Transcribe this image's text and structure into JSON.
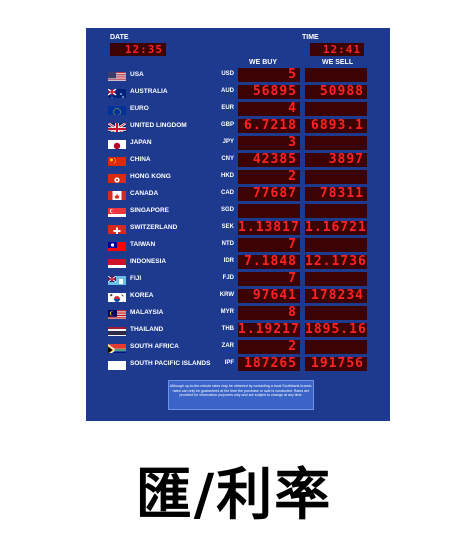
{
  "header": {
    "date_label": "DATE",
    "date_value": "12:35",
    "time_label": "TIME",
    "time_value": "12:41",
    "buy_label": "WE BUY",
    "sell_label": "WE SELL"
  },
  "rates": [
    {
      "country": "USA",
      "code": "USD",
      "buy": "5",
      "sell": "",
      "flag": "flag-usa-icon"
    },
    {
      "country": "AUSTRALIA",
      "code": "AUD",
      "buy": "56895",
      "sell": "50988",
      "flag": "flag-australia-icon"
    },
    {
      "country": "EURO",
      "code": "EUR",
      "buy": "4",
      "sell": "",
      "flag": "flag-euro-icon"
    },
    {
      "country": "UNITED LINGDOM",
      "code": "GBP",
      "buy": "6.7218",
      "sell": "6893.1",
      "flag": "flag-uk-icon"
    },
    {
      "country": "JAPAN",
      "code": "JPY",
      "buy": "3",
      "sell": "",
      "flag": "flag-japan-icon"
    },
    {
      "country": "CHINA",
      "code": "CNY",
      "buy": "42385",
      "sell": "3897",
      "flag": "flag-china-icon"
    },
    {
      "country": "HONG KONG",
      "code": "HKD",
      "buy": "2",
      "sell": "",
      "flag": "flag-hongkong-icon"
    },
    {
      "country": "CANADA",
      "code": "CAD",
      "buy": "77687",
      "sell": "78311",
      "flag": "flag-canada-icon"
    },
    {
      "country": "SINGAPORE",
      "code": "SGD",
      "buy": "",
      "sell": "",
      "flag": "flag-singapore-icon"
    },
    {
      "country": "SWITZERLAND",
      "code": "SEK",
      "buy": "1.13817",
      "sell": "1.16721",
      "flag": "flag-switzerland-icon"
    },
    {
      "country": "TAIWAN",
      "code": "NTD",
      "buy": "7",
      "sell": "",
      "flag": "flag-taiwan-icon"
    },
    {
      "country": "INDONESIA",
      "code": "IDR",
      "buy": "7.1848",
      "sell": "12.1736",
      "flag": "flag-indonesia-icon"
    },
    {
      "country": "FIJI",
      "code": "FJD",
      "buy": "7",
      "sell": "",
      "flag": "flag-fiji-icon"
    },
    {
      "country": "KOREA",
      "code": "KRW",
      "buy": "97641",
      "sell": "178234",
      "flag": "flag-korea-icon"
    },
    {
      "country": "MALAYSIA",
      "code": "MYR",
      "buy": "8",
      "sell": "",
      "flag": "flag-malaysia-icon"
    },
    {
      "country": "THAILAND",
      "code": "THB",
      "buy": "1.19217",
      "sell": "1895.16",
      "flag": "flag-thailand-icon"
    },
    {
      "country": "SOUTH AFRICA",
      "code": "ZAR",
      "buy": "2",
      "sell": "",
      "flag": "flag-southafrica-icon"
    },
    {
      "country": "SOUTH PACIFIC ISLANDS",
      "code": "IPF",
      "buy": "187265",
      "sell": "191756",
      "flag": "flag-blank-icon"
    }
  ],
  "note": "Although up-to-the-minute rates may be obtained by contacting a local Southbank branch, rates can only be guaranteed at the time the purchase or sale is conducted. Rates are provided for information purposes only and are subject to change at any time.",
  "caption": "匯/利率",
  "colors": {
    "board": "#1e3a8f",
    "led_bg": "#3b0303",
    "led_digit": "#ff2222"
  }
}
